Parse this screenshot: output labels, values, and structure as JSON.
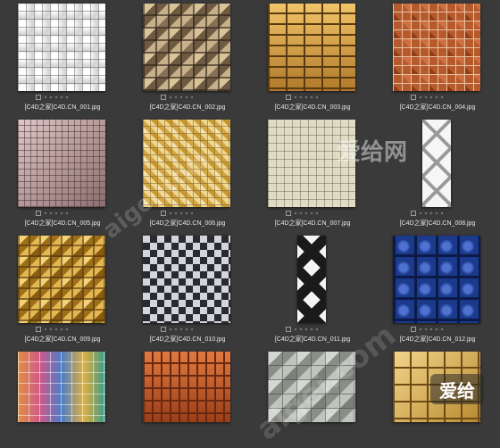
{
  "files": [
    {
      "name": "[C4D之家]C4D.CN_001.jpg",
      "pattern": "white-pearl",
      "tall": false
    },
    {
      "name": "[C4D之家]C4D.CN_002.jpg",
      "pattern": "brown-mixed",
      "tall": false
    },
    {
      "name": "[C4D之家]C4D.CN_003.jpg",
      "pattern": "gold-brick",
      "tall": false
    },
    {
      "name": "[C4D之家]C4D.CN_004.jpg",
      "pattern": "copper-square",
      "tall": false
    },
    {
      "name": "[C4D之家]C4D.CN_005.jpg",
      "pattern": "pink-small",
      "tall": false
    },
    {
      "name": "[C4D之家]C4D.CN_006.jpg",
      "pattern": "yellow-cream",
      "tall": false
    },
    {
      "name": "[C4D之家]C4D.CN_007.jpg",
      "pattern": "cream-grid",
      "tall": false
    },
    {
      "name": "[C4D之家]C4D.CN_008.jpg",
      "pattern": "white-diamond",
      "tall": true
    },
    {
      "name": "[C4D之家]C4D.CN_009.jpg",
      "pattern": "gold-mixed",
      "tall": false
    },
    {
      "name": "[C4D之家]C4D.CN_010.jpg",
      "pattern": "silver-check",
      "tall": false
    },
    {
      "name": "[C4D之家]C4D.CN_011.jpg",
      "pattern": "bw-diamond",
      "tall": true
    },
    {
      "name": "[C4D之家]C4D.CN_012.jpg",
      "pattern": "blue-cross",
      "tall": false
    },
    {
      "name": "",
      "pattern": "rainbow",
      "tall": false
    },
    {
      "name": "",
      "pattern": "orange-brick",
      "tall": false
    },
    {
      "name": "",
      "pattern": "grey-stone",
      "tall": false
    },
    {
      "name": "",
      "pattern": "gold-large",
      "tall": false
    }
  ],
  "watermarks": {
    "logo_text": "爱给网",
    "badge_text": "爱给",
    "site_text": "aigei.com"
  },
  "colors": {
    "background": "#3a3a3a",
    "filename_text": "#e6e6e6"
  }
}
